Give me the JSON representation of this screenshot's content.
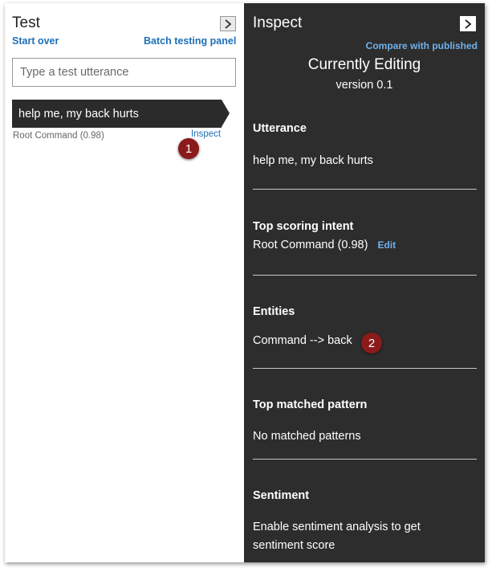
{
  "test_panel": {
    "title": "Test",
    "start_over": "Start over",
    "batch_testing": "Batch testing panel",
    "input_placeholder": "Type a test utterance",
    "selected_utterance": "help me, my back hurts",
    "result_score": "Root Command (0.98)",
    "inspect_link": "Inspect"
  },
  "inspect_panel": {
    "title": "Inspect",
    "compare_link": "Compare with published",
    "editing_title": "Currently Editing",
    "version": "version 0.1",
    "utterance": {
      "heading": "Utterance",
      "value": "help me, my back hurts"
    },
    "top_intent": {
      "heading": "Top scoring intent",
      "value": "Root Command (0.98)",
      "edit": "Edit"
    },
    "entities": {
      "heading": "Entities",
      "value": "Command --> back"
    },
    "top_pattern": {
      "heading": "Top matched pattern",
      "value": "No matched patterns"
    },
    "sentiment": {
      "heading": "Sentiment",
      "value": "Enable sentiment analysis to get sentiment score"
    }
  },
  "callouts": {
    "badge_1": "1",
    "badge_2": "2"
  },
  "colors": {
    "inspect_background": "#2d2d2d",
    "link_blue": "#1e6fb8",
    "link_blue_dark_panel": "#6fb1ea",
    "callout_badge": "#8b1a1a"
  },
  "icons": {
    "expand_left": "chevron-right-icon",
    "expand_right": "chevron-right-icon"
  }
}
